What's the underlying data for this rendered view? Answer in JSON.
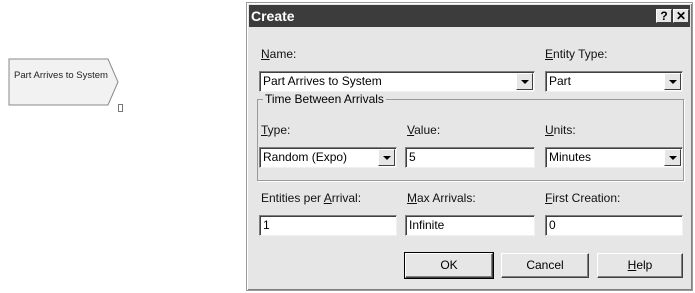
{
  "module": {
    "label": "Part Arrives to System"
  },
  "dialog": {
    "title": "Create",
    "help_button": "?",
    "close_button": "✕",
    "name": {
      "label_prefix": "",
      "label_key": "N",
      "label_rest": "ame:",
      "value": "Part Arrives to System"
    },
    "entity_type": {
      "label_key": "E",
      "label_rest": "ntity Type:",
      "value": "Part"
    },
    "time_group": {
      "title": "Time Between Arrivals"
    },
    "type": {
      "label_key": "T",
      "label_rest": "ype:",
      "value": "Random (Expo)"
    },
    "value": {
      "label_key": "V",
      "label_rest": "alue:",
      "value": "5"
    },
    "units": {
      "label_key": "U",
      "label_rest": "nits:",
      "value": "Minutes"
    },
    "entities_per_arrival": {
      "label_pre": "Entities per ",
      "label_key": "A",
      "label_rest": "rrival:",
      "value": "1"
    },
    "max_arrivals": {
      "label_key": "M",
      "label_rest": "ax Arrivals:",
      "value": "Infinite"
    },
    "first_creation": {
      "label_key": "F",
      "label_rest": "irst Creation:",
      "value": "0"
    },
    "buttons": {
      "ok": "OK",
      "cancel": "Cancel",
      "help_key": "H",
      "help_rest": "elp"
    }
  },
  "colors": {
    "titlebar": "#3c3c3c",
    "dialog_face": "#e6e6e6",
    "module_fill": "#f2f2f2"
  }
}
